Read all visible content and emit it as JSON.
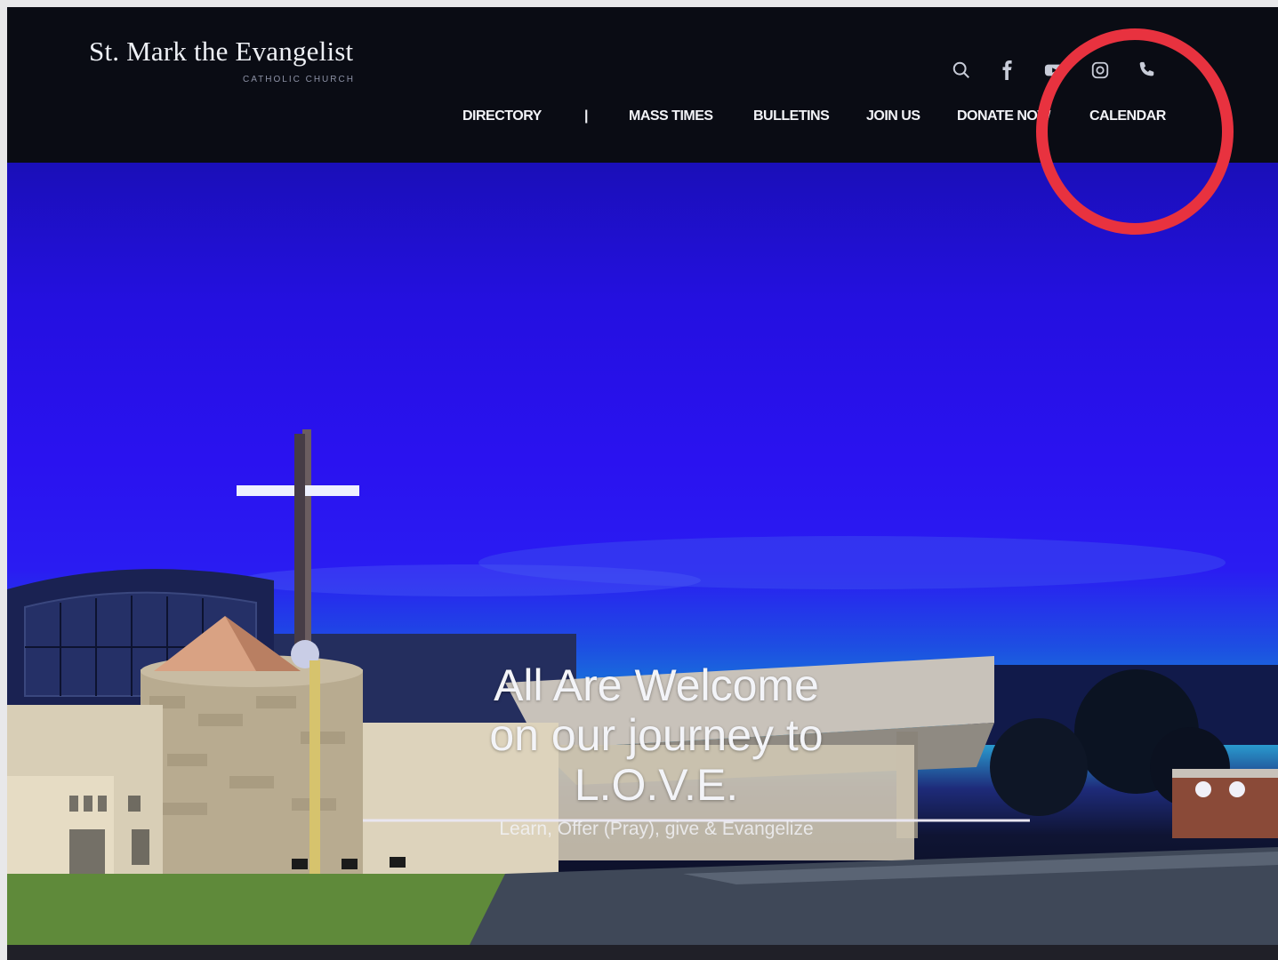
{
  "site": {
    "title": "St. Mark the Evangelist",
    "subtitle": "CATHOLIC CHURCH"
  },
  "header_icons": [
    "search-icon",
    "facebook-icon",
    "youtube-icon",
    "instagram-icon",
    "phone-icon"
  ],
  "nav": {
    "items": [
      "DIRECTORY",
      "MASS TIMES",
      "BULLETINS",
      "JOIN US",
      "DONATE NOW",
      "CALENDAR"
    ],
    "separator": "|"
  },
  "hero": {
    "headline": [
      "All Are Welcome",
      "on our journey to",
      "L.O.V.E."
    ],
    "tagline": "Learn, Offer (Pray), give & Evangelize"
  },
  "colors": {
    "header_bg": "#0a0c14",
    "sky_blue": "#2a12f0",
    "highlight_circle": "#e8323f",
    "nav_text": "#f2f3f7"
  }
}
